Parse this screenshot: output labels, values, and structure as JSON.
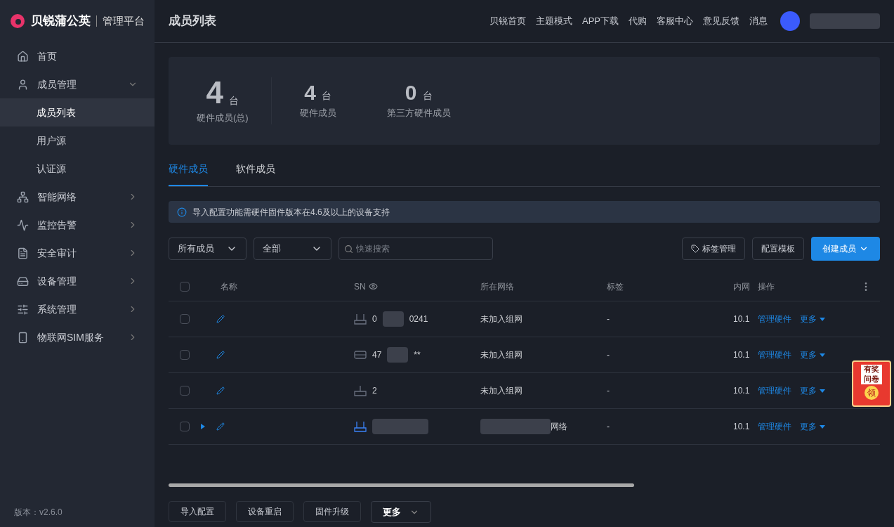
{
  "logo": {
    "brand": "贝锐蒲公英",
    "product": "管理平台"
  },
  "sidebar": {
    "items": [
      {
        "kind": "home",
        "label": "首页",
        "selected": false
      },
      {
        "kind": "user",
        "label": "成员管理",
        "expanded": true,
        "selected": false,
        "children": [
          {
            "label": "成员列表",
            "selected": true
          },
          {
            "label": "用户源",
            "selected": false
          },
          {
            "label": "认证源",
            "selected": false
          }
        ]
      },
      {
        "kind": "network",
        "label": "智能网络",
        "expanded": false,
        "selected": false
      },
      {
        "kind": "monitor",
        "label": "监控告警",
        "expanded": false,
        "selected": false
      },
      {
        "kind": "audit",
        "label": "安全审计",
        "expanded": false,
        "selected": false
      },
      {
        "kind": "device",
        "label": "设备管理",
        "expanded": false,
        "selected": false
      },
      {
        "kind": "system",
        "label": "系统管理",
        "expanded": false,
        "selected": false
      },
      {
        "kind": "sim",
        "label": "物联网SIM服务",
        "expanded": false,
        "selected": false
      }
    ],
    "version": "版本：v2.6.0"
  },
  "header": {
    "title": "成员列表",
    "links": [
      "贝锐首页",
      "主题模式",
      "APP下载",
      "代购",
      "客服中心",
      "意见反馈",
      "消息"
    ]
  },
  "stats": [
    {
      "value": "4",
      "unit": "台",
      "label": "硬件成员(总)"
    },
    {
      "value": "4",
      "unit": "台",
      "label": "硬件成员"
    },
    {
      "value": "0",
      "unit": "台",
      "label": "第三方硬件成员"
    }
  ],
  "tabs": [
    {
      "label": "硬件成员",
      "selected": true
    },
    {
      "label": "软件成员",
      "selected": false
    }
  ],
  "notice": "导入配置功能需硬件固件版本在4.6及以上的设备支持",
  "filters": {
    "member_select": "所有成员",
    "status_select": "全部",
    "search": {
      "placeholder": "快速搜索"
    }
  },
  "actions": {
    "tags": "标签管理",
    "template": "配置模板",
    "create": "创建成员"
  },
  "table": {
    "select_all_checked": false,
    "columns": [
      "名称",
      "SN",
      "所在网络",
      "标签",
      "内网",
      "操作"
    ],
    "rows": [
      {
        "kind": "router",
        "checked": false,
        "sn": [
          "0",
          "0241"
        ],
        "network": "未加入组网",
        "tag": "-",
        "ip": "10.1",
        "manage": "管理硬件",
        "more": "更多",
        "expandable": false
      },
      {
        "kind": "box",
        "checked": false,
        "sn": [
          "47",
          "**"
        ],
        "network": "未加入组网",
        "tag": "-",
        "ip": "10.1",
        "manage": "管理硬件",
        "more": "更多",
        "expandable": false
      },
      {
        "kind": "antenna",
        "checked": false,
        "sn": [
          "2"
        ],
        "network": "未加入组网",
        "tag": "-",
        "ip": "10.1",
        "manage": "管理硬件",
        "more": "更多",
        "expandable": false
      },
      {
        "kind": "router_active",
        "checked": false,
        "network": "网络",
        "tag": "-",
        "ip": "10.1",
        "manage": "管理硬件",
        "more": "更多",
        "expandable": true
      }
    ]
  },
  "bottom_buttons": [
    "导入配置",
    "设备重启",
    "固件升级"
  ],
  "bottom_more": "更多",
  "promo": {
    "line1": "有奖",
    "line2": "问卷",
    "coin": "领"
  }
}
